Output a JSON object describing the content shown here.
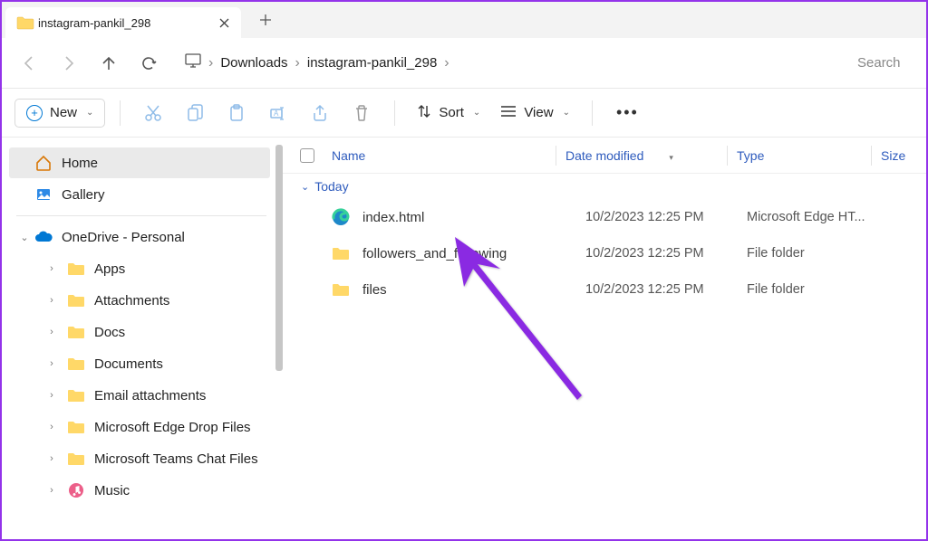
{
  "tab": {
    "title": "instagram-pankil_298"
  },
  "breadcrumb": {
    "seg1": "Downloads",
    "seg2": "instagram-pankil_298"
  },
  "search": {
    "placeholder": "Search"
  },
  "toolbar": {
    "new_label": "New",
    "sort_label": "Sort",
    "view_label": "View"
  },
  "sidebar": {
    "home": "Home",
    "gallery": "Gallery",
    "onedrive": "OneDrive - Personal",
    "children": [
      {
        "label": "Apps"
      },
      {
        "label": "Attachments"
      },
      {
        "label": "Docs"
      },
      {
        "label": "Documents"
      },
      {
        "label": "Email attachments"
      },
      {
        "label": "Microsoft Edge Drop Files"
      },
      {
        "label": "Microsoft Teams Chat Files"
      },
      {
        "label": "Music"
      }
    ]
  },
  "columns": {
    "name": "Name",
    "date": "Date modified",
    "type": "Type",
    "size": "Size"
  },
  "group": {
    "today": "Today"
  },
  "files": [
    {
      "name": "index.html",
      "date": "10/2/2023 12:25 PM",
      "type": "Microsoft Edge HT...",
      "icon": "edge"
    },
    {
      "name": "followers_and_following",
      "date": "10/2/2023 12:25 PM",
      "type": "File folder",
      "icon": "folder"
    },
    {
      "name": "files",
      "date": "10/2/2023 12:25 PM",
      "type": "File folder",
      "icon": "folder"
    }
  ]
}
